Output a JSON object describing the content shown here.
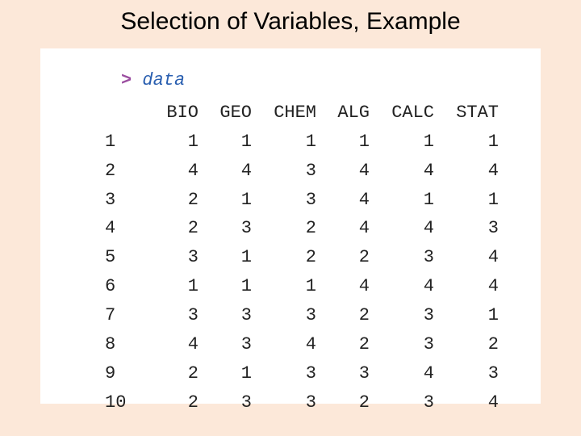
{
  "title": "Selection of Variables, Example",
  "console": {
    "prompt": ">",
    "command": "data",
    "columns": [
      "BIO",
      "GEO",
      "CHEM",
      "ALG",
      "CALC",
      "STAT"
    ],
    "rows": [
      {
        "label": "1",
        "values": [
          1,
          1,
          1,
          1,
          1,
          1
        ]
      },
      {
        "label": "2",
        "values": [
          4,
          4,
          3,
          4,
          4,
          4
        ]
      },
      {
        "label": "3",
        "values": [
          2,
          1,
          3,
          4,
          1,
          1
        ]
      },
      {
        "label": "4",
        "values": [
          2,
          3,
          2,
          4,
          4,
          3
        ]
      },
      {
        "label": "5",
        "values": [
          3,
          1,
          2,
          2,
          3,
          4
        ]
      },
      {
        "label": "6",
        "values": [
          1,
          1,
          1,
          4,
          4,
          4
        ]
      },
      {
        "label": "7",
        "values": [
          3,
          3,
          3,
          2,
          3,
          1
        ]
      },
      {
        "label": "8",
        "values": [
          4,
          3,
          4,
          2,
          3,
          2
        ]
      },
      {
        "label": "9",
        "values": [
          2,
          1,
          3,
          3,
          4,
          3
        ]
      },
      {
        "label": "10",
        "values": [
          2,
          3,
          3,
          2,
          3,
          4
        ]
      }
    ]
  },
  "chart_data": {
    "type": "table",
    "title": "Selection of Variables, Example",
    "columns": [
      "",
      "BIO",
      "GEO",
      "CHEM",
      "ALG",
      "CALC",
      "STAT"
    ],
    "rows": [
      [
        "1",
        1,
        1,
        1,
        1,
        1,
        1
      ],
      [
        "2",
        4,
        4,
        3,
        4,
        4,
        4
      ],
      [
        "3",
        2,
        1,
        3,
        4,
        1,
        1
      ],
      [
        "4",
        2,
        3,
        2,
        4,
        4,
        3
      ],
      [
        "5",
        3,
        1,
        2,
        2,
        3,
        4
      ],
      [
        "6",
        1,
        1,
        1,
        4,
        4,
        4
      ],
      [
        "7",
        3,
        3,
        3,
        2,
        3,
        1
      ],
      [
        "8",
        4,
        3,
        4,
        2,
        3,
        2
      ],
      [
        "9",
        2,
        1,
        3,
        3,
        4,
        3
      ],
      [
        "10",
        2,
        3,
        3,
        2,
        3,
        4
      ]
    ]
  }
}
